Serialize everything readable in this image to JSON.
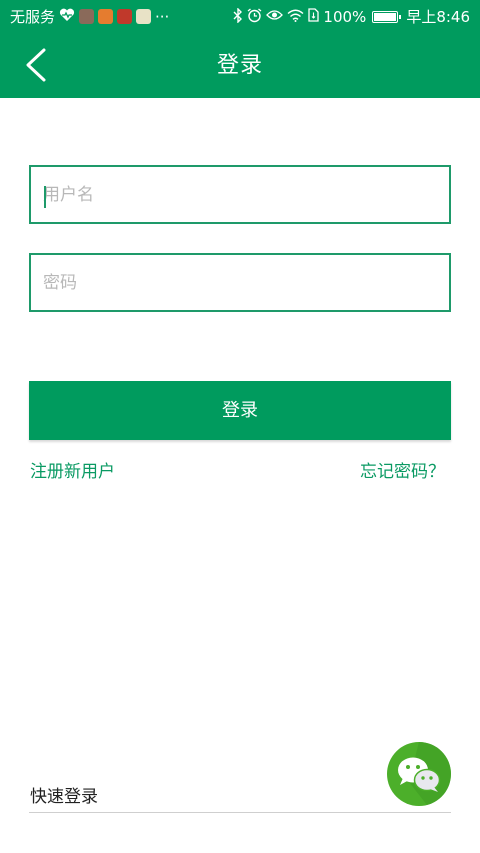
{
  "status_bar": {
    "carrier": "无服务",
    "more_indicator": "···",
    "battery_percent": "100%",
    "time": "早上8:46",
    "icons": [
      "heart-pulse-icon",
      "app-icon-1",
      "app-icon-2",
      "app-icon-3",
      "app-icon-4",
      "bluetooth-icon",
      "alarm-icon",
      "eye-icon",
      "wifi-icon",
      "sim-icon",
      "battery-icon"
    ]
  },
  "header": {
    "title": "登录",
    "back_icon": "chevron-left-icon"
  },
  "form": {
    "username_placeholder": "用户名",
    "password_placeholder": "密码",
    "login_label": "登录"
  },
  "links": {
    "register": "注册新用户",
    "forgot_password": "忘记密码？"
  },
  "quick_login": {
    "label": "快速登录",
    "wechat_icon": "wechat-icon"
  },
  "colors": {
    "primary": "#009b5e",
    "border": "#1e9a6a",
    "wechat_green": "#4caf2a"
  }
}
